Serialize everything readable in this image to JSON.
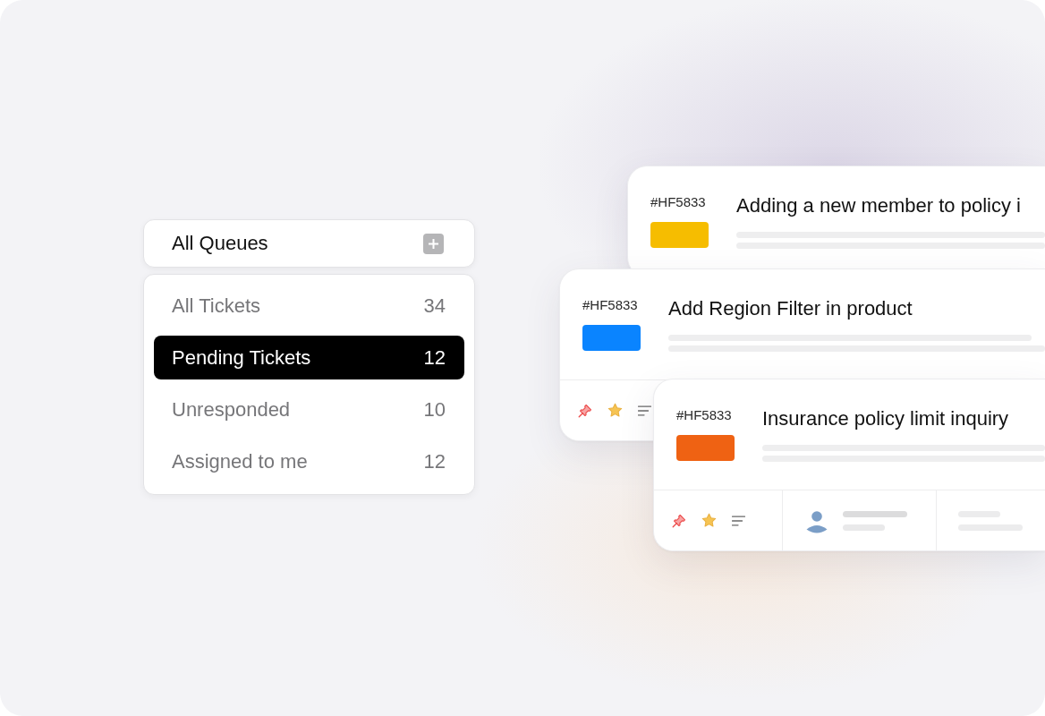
{
  "queues": {
    "title": "All Queues",
    "items": [
      {
        "label": "All Tickets",
        "count": "34",
        "selected": false
      },
      {
        "label": "Pending Tickets",
        "count": "12",
        "selected": true
      },
      {
        "label": "Unresponded",
        "count": "10",
        "selected": false
      },
      {
        "label": "Assigned to me",
        "count": "12",
        "selected": false
      }
    ]
  },
  "tickets": [
    {
      "id": "#HF5833",
      "title": "Adding a new member to policy i",
      "color": "#f6bd00"
    },
    {
      "id": "#HF5833",
      "title": "Add Region Filter in product",
      "color": "#0a84ff",
      "footer": {
        "pinned": true,
        "starred": true
      }
    },
    {
      "id": "#HF5833",
      "title": "Insurance policy limit inquiry",
      "color": "#ef6213",
      "footer": {
        "pinned": true,
        "starred": true,
        "columns": [
          {
            "kind": "assignee"
          },
          {
            "kind": "details"
          }
        ]
      }
    }
  ]
}
